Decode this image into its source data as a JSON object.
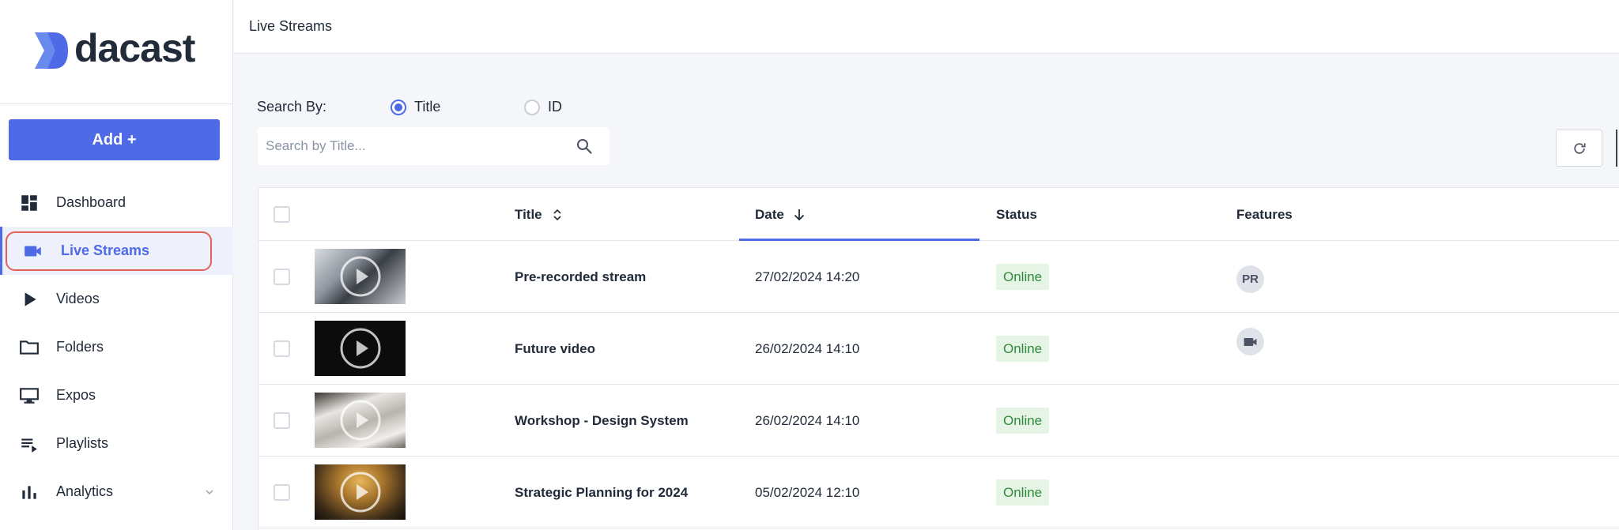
{
  "brand": {
    "name": "dacast",
    "color": "#4e6ae6"
  },
  "sidebar": {
    "add_button": "Add +",
    "items": [
      {
        "label": "Dashboard",
        "icon": "dashboard-icon"
      },
      {
        "label": "Live Streams",
        "icon": "videocam-icon",
        "active": true
      },
      {
        "label": "Videos",
        "icon": "play-icon"
      },
      {
        "label": "Folders",
        "icon": "folder-icon"
      },
      {
        "label": "Expos",
        "icon": "monitor-icon"
      },
      {
        "label": "Playlists",
        "icon": "playlist-icon"
      },
      {
        "label": "Analytics",
        "icon": "bar-chart-icon",
        "expandable": true
      }
    ]
  },
  "header": {
    "title": "Live Streams"
  },
  "search": {
    "by_label": "Search By:",
    "options": [
      {
        "label": "Title",
        "checked": true
      },
      {
        "label": "ID",
        "checked": false
      }
    ],
    "placeholder": "Search by Title..."
  },
  "table": {
    "columns": {
      "title": "Title",
      "date": "Date",
      "status": "Status",
      "features": "Features"
    },
    "sort": {
      "column": "Date",
      "direction": "descending"
    },
    "rows": [
      {
        "title": "Pre-recorded stream",
        "date": "27/02/2024 14:20",
        "status": "Online",
        "feature": "PR",
        "feature_icon": ""
      },
      {
        "title": "Future video",
        "date": "26/02/2024 14:10",
        "status": "Online",
        "feature": "",
        "feature_icon": "videocam-icon"
      },
      {
        "title": "Workshop - Design System",
        "date": "26/02/2024 14:10",
        "status": "Online",
        "feature": "",
        "feature_icon": ""
      },
      {
        "title": "Strategic Planning for 2024",
        "date": "05/02/2024 12:10",
        "status": "Online",
        "feature": "",
        "feature_icon": ""
      }
    ]
  },
  "colors": {
    "accent": "#4e6ae6",
    "online_text": "#2e8a3a",
    "online_bg": "#e6f4e6",
    "highlight_ring": "#e0605a"
  }
}
